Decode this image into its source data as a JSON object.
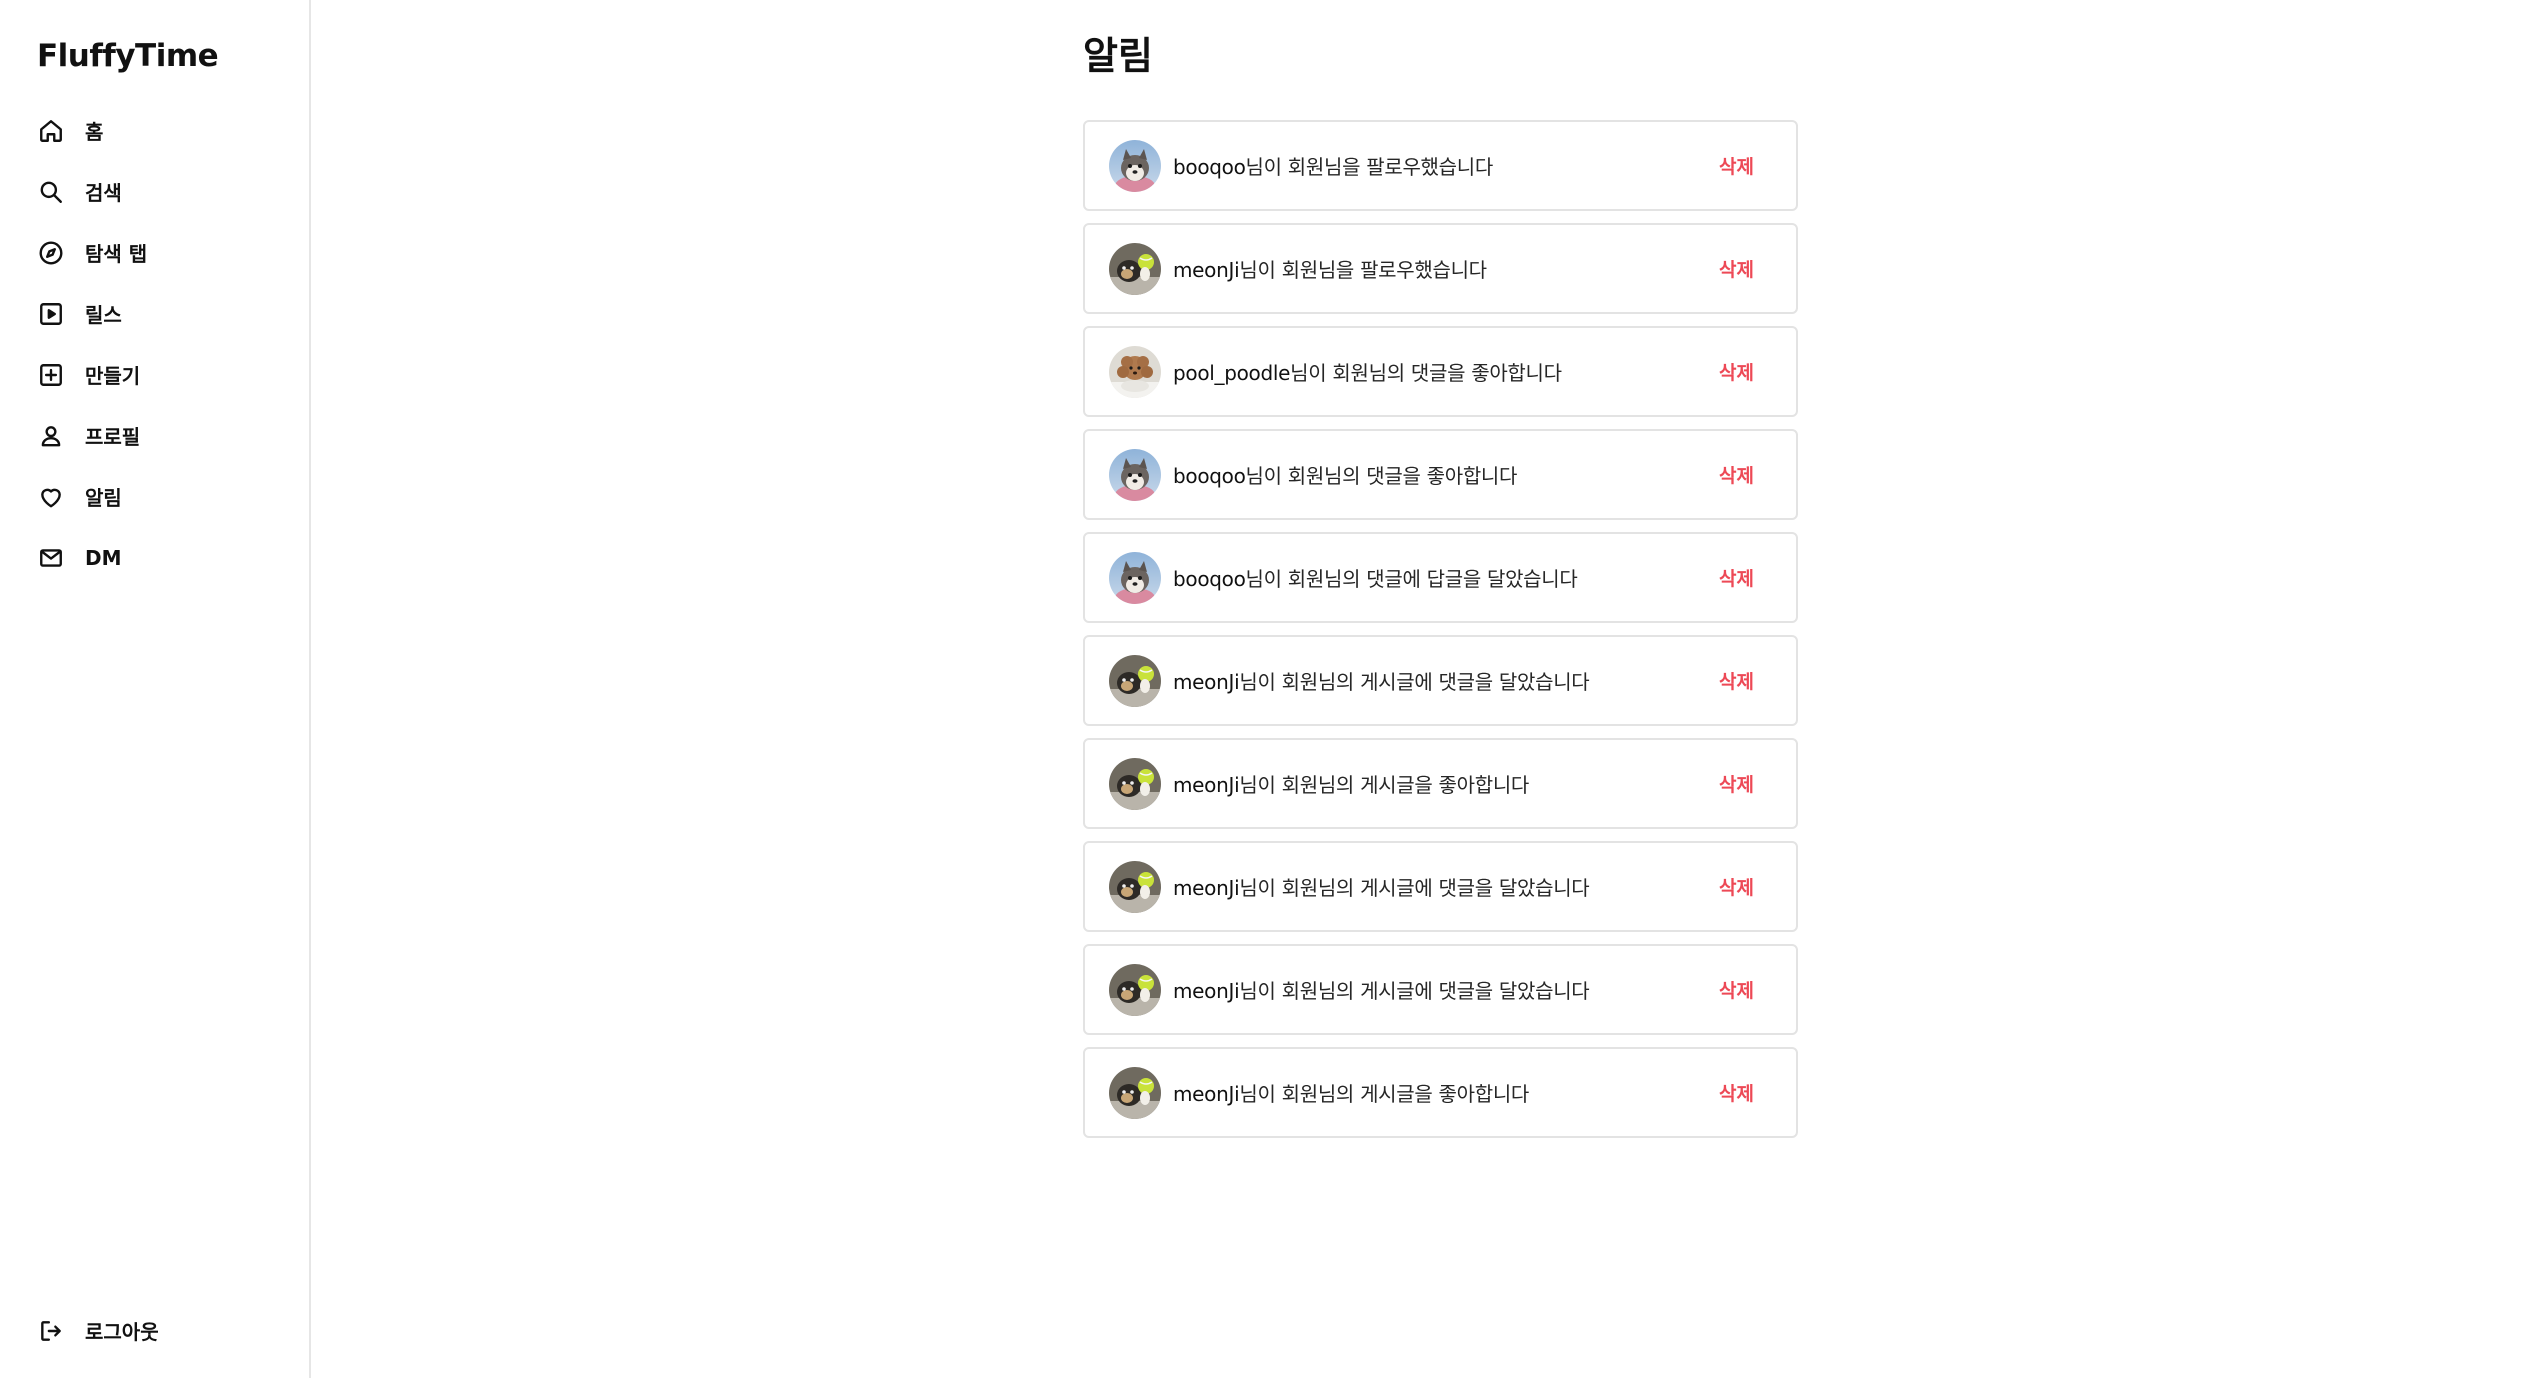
{
  "app": {
    "brand": "FluffyTime"
  },
  "sidebar": {
    "items": [
      {
        "label": "홈",
        "icon": "home-icon"
      },
      {
        "label": "검색",
        "icon": "search-icon"
      },
      {
        "label": "탐색 탭",
        "icon": "compass-icon"
      },
      {
        "label": "릴스",
        "icon": "reels-icon"
      },
      {
        "label": "만들기",
        "icon": "plus-square-icon"
      },
      {
        "label": "프로필",
        "icon": "user-icon"
      },
      {
        "label": "알림",
        "icon": "heart-icon"
      },
      {
        "label": "DM",
        "icon": "mail-icon"
      }
    ],
    "logout": {
      "label": "로그아웃",
      "icon": "logout-icon"
    }
  },
  "main": {
    "title": "알림",
    "delete_label": "삭제",
    "delete_color": "#ed4956",
    "notifications": [
      {
        "user": "booqoo",
        "message": "님이 회원님을 팔로우했습니다",
        "avatar": "husky"
      },
      {
        "user": "meonJi",
        "message": "님이 회원님을 팔로우했습니다",
        "avatar": "dog-ball"
      },
      {
        "user": "pool_poodle",
        "message": "님이 회원님의 댓글을 좋아합니다",
        "avatar": "poodle"
      },
      {
        "user": "booqoo",
        "message": "님이 회원님의 댓글을 좋아합니다",
        "avatar": "husky"
      },
      {
        "user": "booqoo",
        "message": "님이 회원님의 댓글에 답글을 달았습니다",
        "avatar": "husky"
      },
      {
        "user": "meonJi",
        "message": "님이 회원님의 게시글에 댓글을 달았습니다",
        "avatar": "dog-ball"
      },
      {
        "user": "meonJi",
        "message": "님이 회원님의 게시글을 좋아합니다",
        "avatar": "dog-ball"
      },
      {
        "user": "meonJi",
        "message": "님이 회원님의 게시글에 댓글을 달았습니다",
        "avatar": "dog-ball"
      },
      {
        "user": "meonJi",
        "message": "님이 회원님의 게시글에 댓글을 달았습니다",
        "avatar": "dog-ball"
      },
      {
        "user": "meonJi",
        "message": "님이 회원님의 게시글을 좋아합니다",
        "avatar": "dog-ball"
      }
    ]
  }
}
